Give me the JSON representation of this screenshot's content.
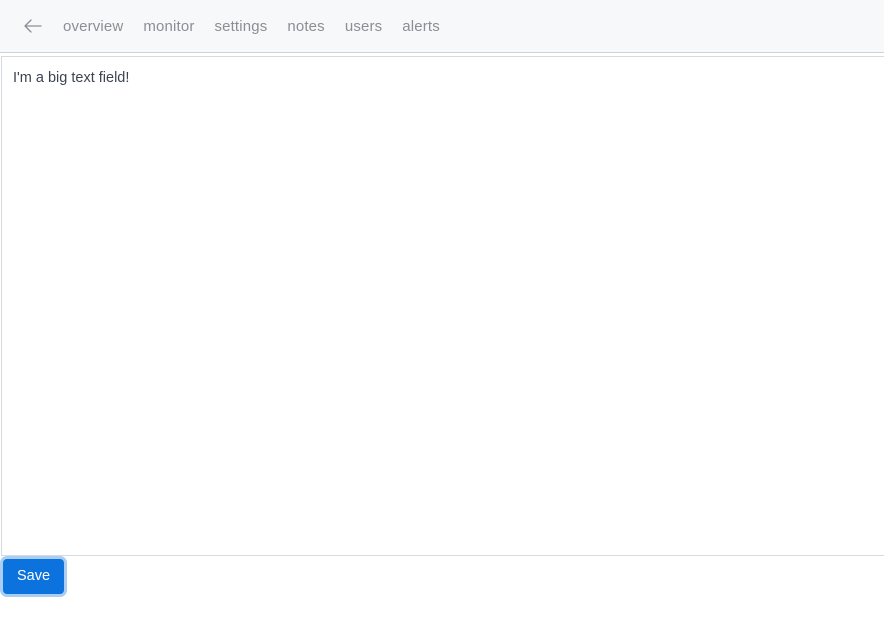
{
  "header": {
    "back_icon": "arrow-left-icon",
    "nav_items": [
      {
        "label": "overview"
      },
      {
        "label": "monitor"
      },
      {
        "label": "settings"
      },
      {
        "label": "notes"
      },
      {
        "label": "users"
      },
      {
        "label": "alerts"
      }
    ]
  },
  "editor": {
    "value": "I'm a big text field!",
    "placeholder": ""
  },
  "footer": {
    "save_label": "Save"
  },
  "colors": {
    "header_bg": "#f7f8fa",
    "header_border": "#ced3db",
    "nav_text": "#8b8e95",
    "editor_border": "#d7dae0",
    "editor_text": "#3c4451",
    "accent": "#0c72dd",
    "focus_ring": "#a9cdf3",
    "page_bg": "#ffffff"
  }
}
